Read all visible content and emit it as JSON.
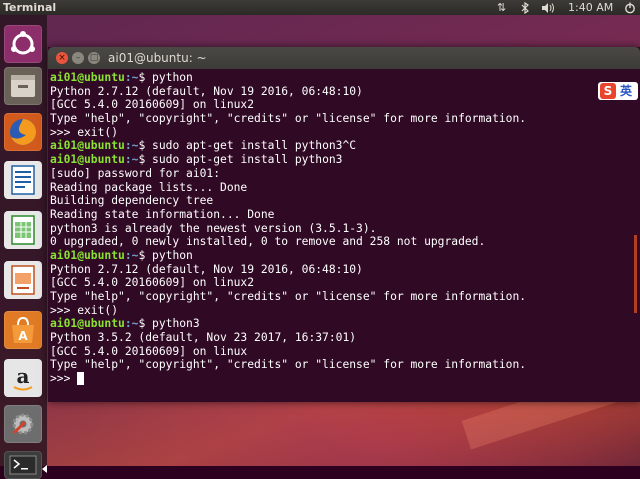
{
  "top_panel": {
    "app_title": "Terminal",
    "time": "1:40 AM",
    "indicators": [
      "network-icon",
      "bluetooth-icon",
      "volume-icon"
    ]
  },
  "launcher": {
    "items": [
      {
        "icon": "ubuntu-dash-icon"
      },
      {
        "icon": "files-icon"
      },
      {
        "icon": "firefox-icon"
      },
      {
        "icon": "writer-icon"
      },
      {
        "icon": "calc-icon"
      },
      {
        "icon": "impress-icon"
      },
      {
        "icon": "software-center-icon"
      },
      {
        "icon": "amazon-icon"
      },
      {
        "icon": "system-settings-icon"
      },
      {
        "icon": "terminal-icon"
      }
    ]
  },
  "window": {
    "title": "ai01@ubuntu: ~",
    "close_symbol": "×",
    "min_symbol": "–",
    "max_symbol": "□"
  },
  "terminal": {
    "user_host": "ai01@ubuntu",
    "path": ":~",
    "lines": [
      {
        "type": "prompt",
        "cmd": "$ python"
      },
      {
        "type": "out",
        "text": "Python 2.7.12 (default, Nov 19 2016, 06:48:10)"
      },
      {
        "type": "out",
        "text": "[GCC 5.4.0 20160609] on linux2"
      },
      {
        "type": "out",
        "text": "Type \"help\", \"copyright\", \"credits\" or \"license\" for more information."
      },
      {
        "type": "out",
        "text": ">>> exit()"
      },
      {
        "type": "prompt",
        "cmd": "$ sudo apt-get install python3^C"
      },
      {
        "type": "prompt",
        "cmd": "$ sudo apt-get install python3"
      },
      {
        "type": "out",
        "text": "[sudo] password for ai01:"
      },
      {
        "type": "out",
        "text": "Reading package lists... Done"
      },
      {
        "type": "out",
        "text": "Building dependency tree"
      },
      {
        "type": "out",
        "text": "Reading state information... Done"
      },
      {
        "type": "out",
        "text": "python3 is already the newest version (3.5.1-3)."
      },
      {
        "type": "out",
        "text": "0 upgraded, 0 newly installed, 0 to remove and 258 not upgraded."
      },
      {
        "type": "prompt",
        "cmd": "$ python"
      },
      {
        "type": "out",
        "text": "Python 2.7.12 (default, Nov 19 2016, 06:48:10)"
      },
      {
        "type": "out",
        "text": "[GCC 5.4.0 20160609] on linux2"
      },
      {
        "type": "out",
        "text": "Type \"help\", \"copyright\", \"credits\" or \"license\" for more information."
      },
      {
        "type": "out",
        "text": ">>> exit()"
      },
      {
        "type": "prompt",
        "cmd": "$ python3"
      },
      {
        "type": "out",
        "text": "Python 3.5.2 (default, Nov 23 2017, 16:37:01)"
      },
      {
        "type": "out",
        "text": "[GCC 5.4.0 20160609] on linux"
      },
      {
        "type": "out",
        "text": "Type \"help\", \"copyright\", \"credits\" or \"license\" for more information."
      },
      {
        "type": "current",
        "text": ">>> "
      }
    ]
  },
  "ime": {
    "logo": "S",
    "lang": "英"
  },
  "colors": {
    "terminal_bg": "#300a24",
    "prompt_user": "#8ae234",
    "prompt_path": "#729fcf",
    "accent": "#e95420"
  }
}
